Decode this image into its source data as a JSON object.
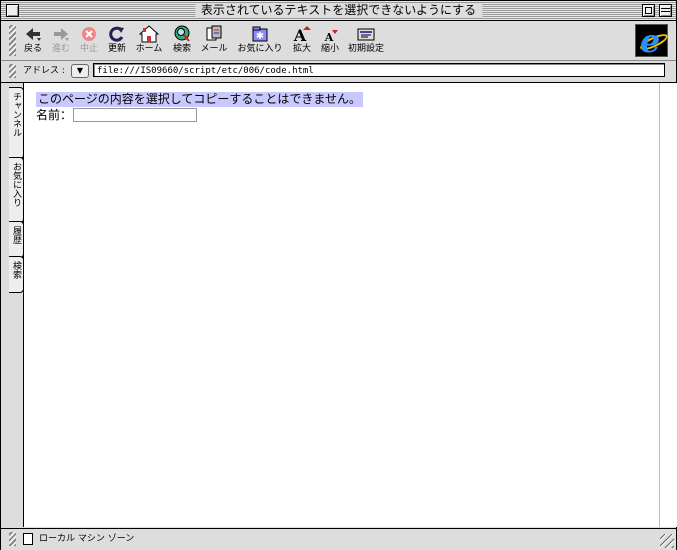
{
  "window": {
    "title": "表示されているテキストを選択できないようにする"
  },
  "toolbar": {
    "buttons": [
      {
        "label": "戻る",
        "icon": "back-arrow-icon",
        "enabled": true
      },
      {
        "label": "進む",
        "icon": "forward-arrow-icon",
        "enabled": false
      },
      {
        "label": "中止",
        "icon": "stop-icon",
        "enabled": false
      },
      {
        "label": "更新",
        "icon": "refresh-icon",
        "enabled": true
      },
      {
        "label": "ホーム",
        "icon": "home-icon",
        "enabled": true
      },
      {
        "label": "検索",
        "icon": "search-globe-icon",
        "enabled": true
      },
      {
        "label": "メール",
        "icon": "mail-icon",
        "enabled": true
      },
      {
        "label": "お気に入り",
        "icon": "favorites-icon",
        "enabled": true
      },
      {
        "label": "拡大",
        "icon": "text-larger-icon",
        "enabled": true
      },
      {
        "label": "縮小",
        "icon": "text-smaller-icon",
        "enabled": true
      },
      {
        "label": "初期設定",
        "icon": "preferences-icon",
        "enabled": true
      }
    ],
    "brand_icon": "ie-logo-icon"
  },
  "address": {
    "label": "アドレス :",
    "value": "file:///IS09660/script/etc/006/code.html"
  },
  "sidebar": {
    "tabs": [
      {
        "label": "チャンネル"
      },
      {
        "label": "お気に入り"
      },
      {
        "label": "履歴"
      },
      {
        "label": "検索"
      }
    ]
  },
  "content": {
    "notice": "このページの内容を選択してコピーすることはできません。",
    "name_label": "名前：",
    "name_value": "",
    "highlight_color": "#c8c8ff"
  },
  "status": {
    "zone": "ローカル マシン ゾーン"
  }
}
